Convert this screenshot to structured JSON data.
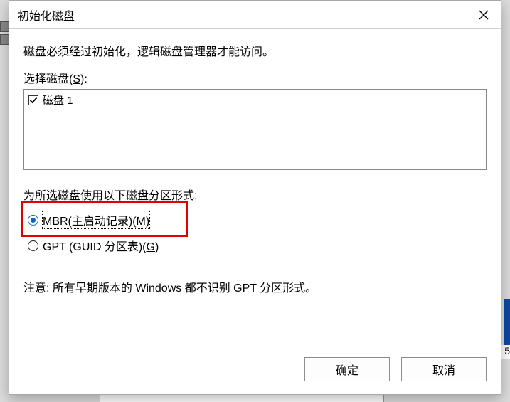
{
  "bg": {
    "corner_val": "5"
  },
  "dialog": {
    "title": "初始化磁盘",
    "intro_text": "磁盘必须经过初始化，逻辑磁盘管理器才能访问。",
    "select_label_pre": "选择磁盘(",
    "select_label_hot": "S",
    "select_label_post": "):",
    "disks": [
      {
        "label": "磁盘 1",
        "checked": true
      }
    ],
    "partition_style_label": "为所选磁盘使用以下磁盘分区形式:",
    "radios": {
      "mbr": {
        "pre": "MBR(主启动记录)(",
        "hot": "M",
        "post": ")",
        "selected": true
      },
      "gpt": {
        "pre": "GPT (GUID 分区表)(",
        "hot": "G",
        "post": ")",
        "selected": false
      }
    },
    "note_text": "注意: 所有早期版本的 Windows 都不识别 GPT 分区形式。",
    "ok_label": "确定",
    "cancel_label": "取消"
  }
}
